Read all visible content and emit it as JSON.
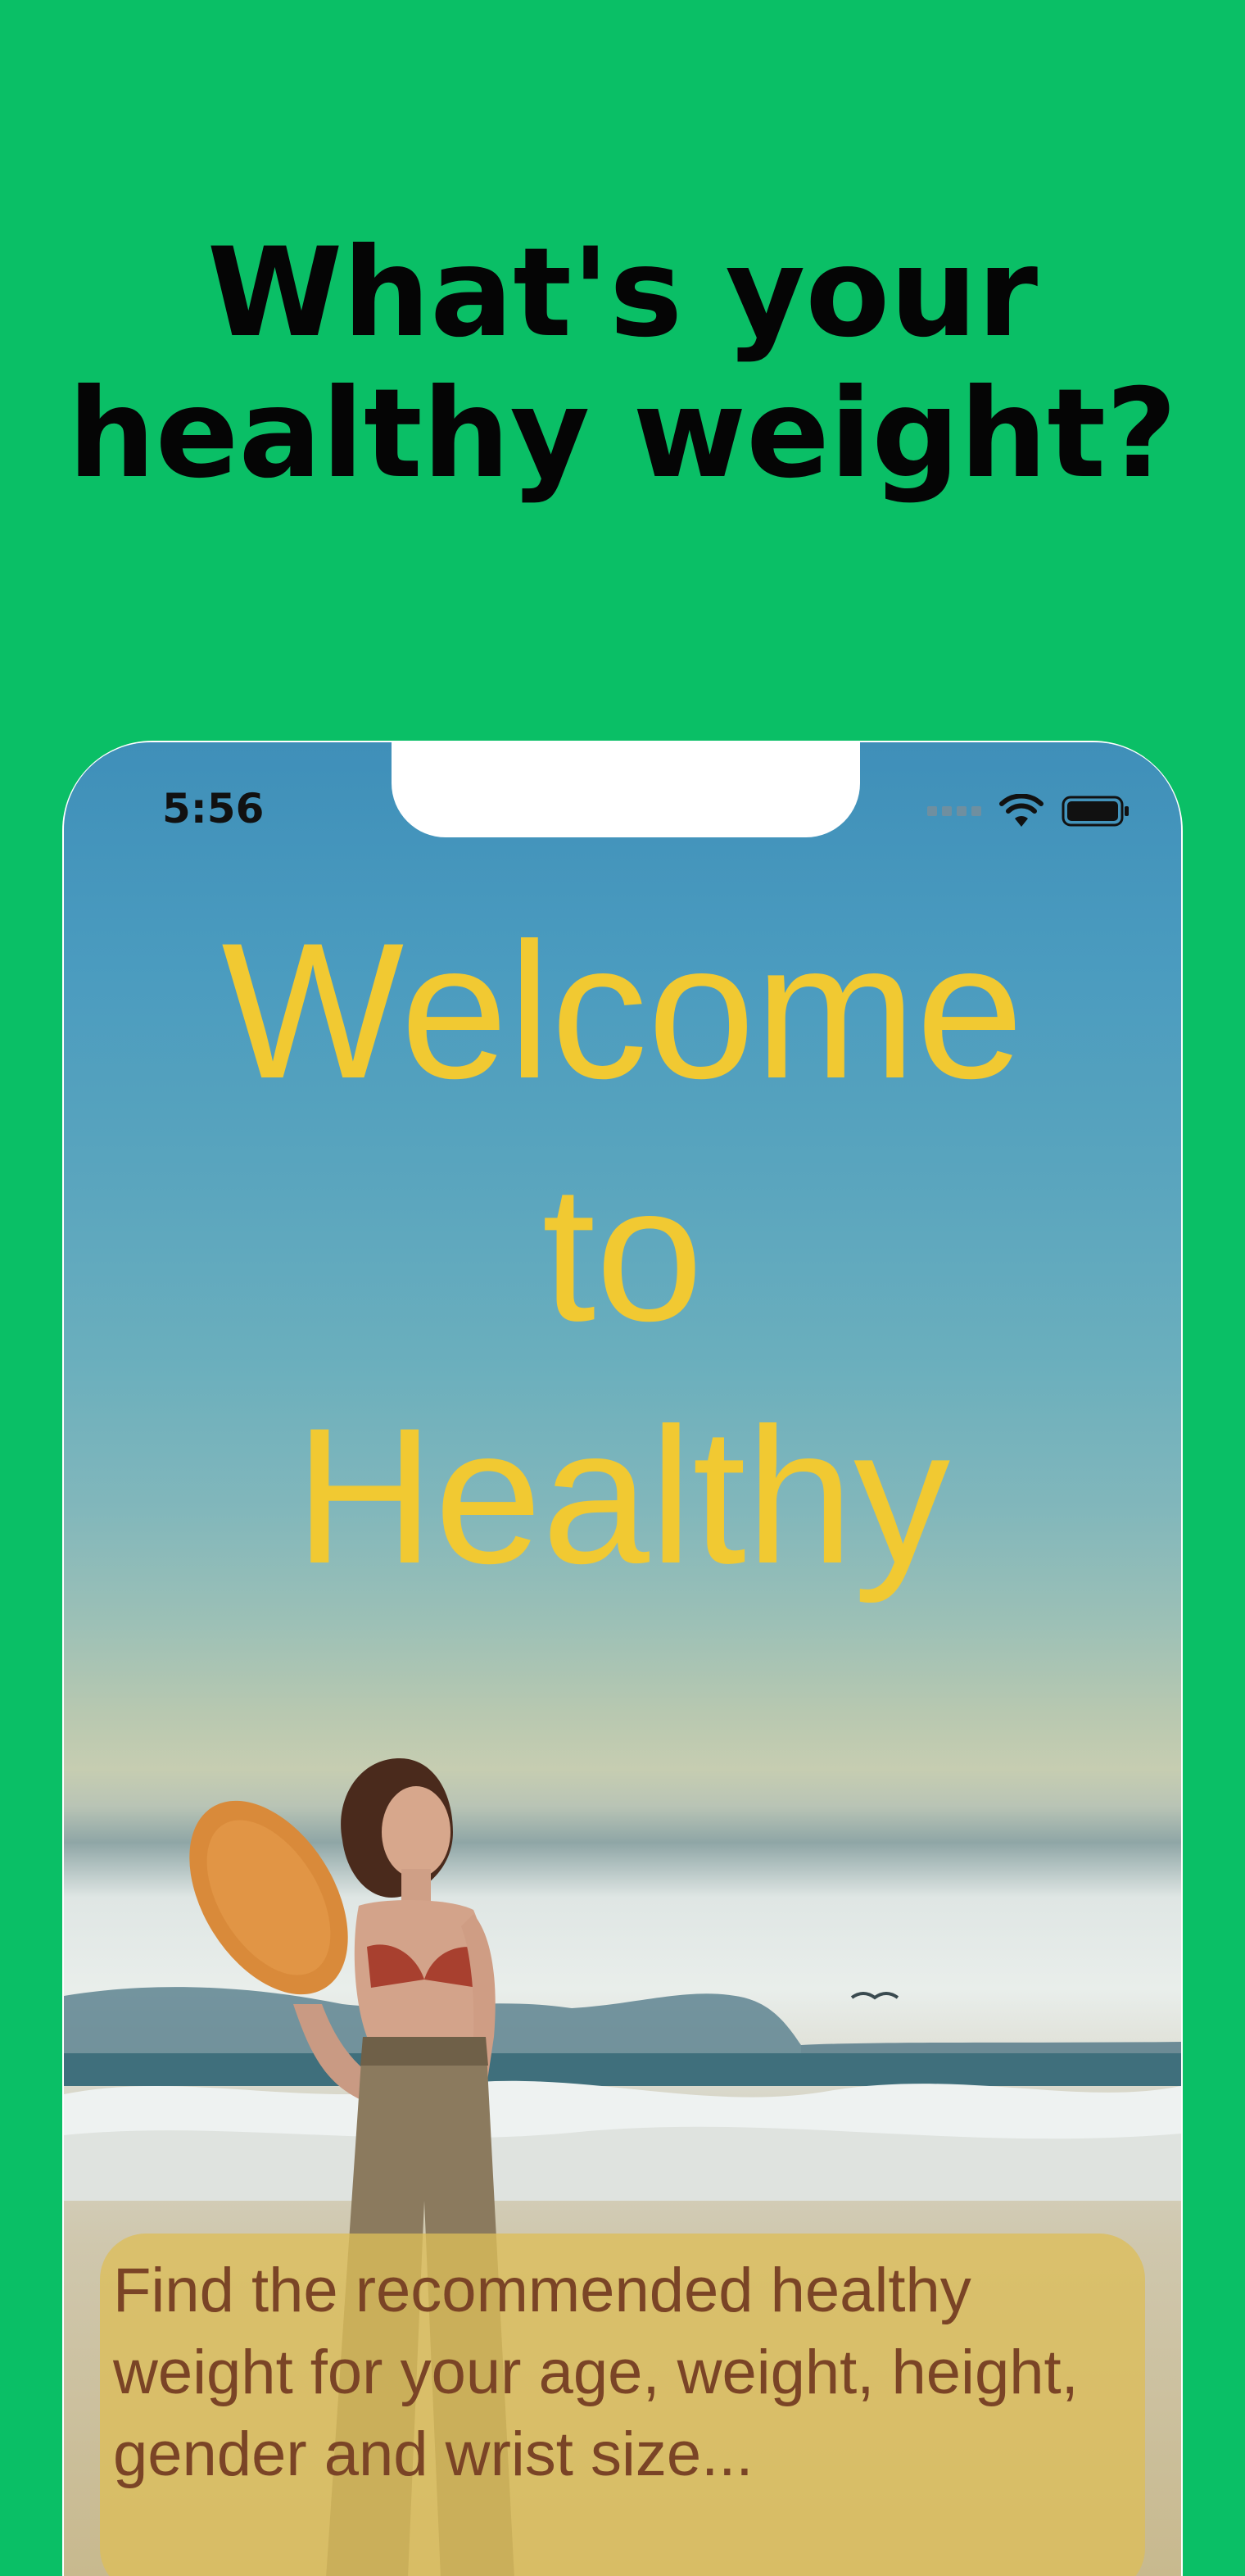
{
  "headline": {
    "line1": "What's your",
    "line2": "healthy weight?"
  },
  "status_bar": {
    "time": "5:56",
    "icons": [
      "signal-icon",
      "wifi-icon",
      "battery-icon"
    ]
  },
  "welcome": {
    "line1": "Welcome",
    "line2": "to",
    "line3": "Healthy"
  },
  "description": {
    "text": "Find the recommended healthy weight for your age, weight, height, gender and wrist size..."
  },
  "colors": {
    "background": "#0abf66",
    "headline": "#050505",
    "welcome_text": "#f1c932",
    "description_text": "#7a4426",
    "description_card": "#dcbe5a"
  }
}
